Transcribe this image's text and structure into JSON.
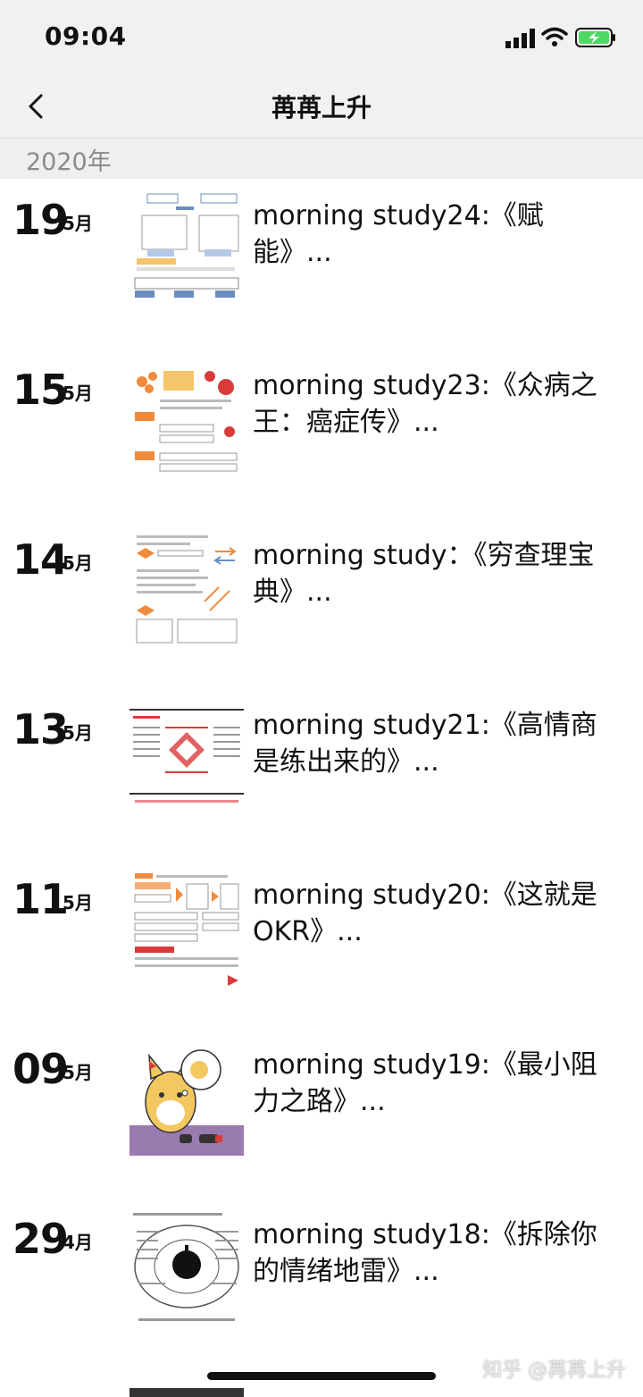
{
  "status_bar": {
    "time": "09:04"
  },
  "nav": {
    "title": "苒苒上升"
  },
  "section": {
    "year": "2020年"
  },
  "entries": [
    {
      "day": "19",
      "month": "5月",
      "title": "morning study24:《赋能》..."
    },
    {
      "day": "15",
      "month": "5月",
      "title": "morning study23:《众病之王：癌症传》..."
    },
    {
      "day": "14",
      "month": "5月",
      "title": "morning study：《穷查理宝典》..."
    },
    {
      "day": "13",
      "month": "5月",
      "title": "morning study21:《高情商是练出来的》..."
    },
    {
      "day": "11",
      "month": "5月",
      "title": "morning study20:《这就是OKR》..."
    },
    {
      "day": "09",
      "month": "5月",
      "title": "morning study19:《最小阻力之路》..."
    },
    {
      "day": "29",
      "month": "4月",
      "title": "morning study18:《拆除你的情绪地雷》..."
    }
  ],
  "watermark": "知乎 @苒苒上升",
  "colors": {
    "bar_bg": "#f1f1f1",
    "year_text": "#8b8b8b",
    "battery_green": "#4cd964"
  }
}
